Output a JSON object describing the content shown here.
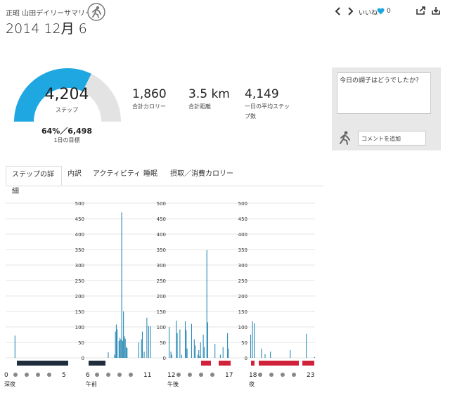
{
  "header": {
    "title": "正昭 山田デイリーサマリー",
    "date": "2014 12月 6",
    "like_label": "いいね",
    "like_count": "0"
  },
  "summary": {
    "steps": "4,204",
    "steps_label": "ステップ",
    "goal_text": "64%／6,498",
    "goal_label": "1日の目標",
    "goal_fraction": 0.647,
    "calories": "1,860",
    "calories_label": "合計カロリー",
    "distance": "3.5 km",
    "distance_label": "合計距離",
    "avg_steps": "4,149",
    "avg_steps_label_1": "一日の平均ステッ",
    "avg_steps_label_2": "プ数"
  },
  "comment": {
    "placeholder": "今日の調子はどうでしたか？",
    "add_button": "コメントを追加"
  },
  "tabs": [
    "ステップの詳細",
    "内訳",
    "アクティビティ",
    "睡眠",
    "摂取／消費カロリー"
  ],
  "colors": {
    "accent": "#1ea7e1",
    "bar": "#2a8ab5",
    "gauge_rest": "#e3e3e3",
    "sleep_dark": "#1f2d3d",
    "sleep_red": "#d0223a"
  },
  "chart_data": {
    "type": "bar",
    "ylim": [
      0,
      500
    ],
    "yticks": [
      "500",
      "450",
      "400",
      "350",
      "300",
      "250",
      "200",
      "150",
      "100",
      "50",
      "0"
    ],
    "panels": [
      {
        "period": "深夜",
        "start_hour": 0,
        "x_labels": [
          "0",
          "5"
        ],
        "values": [
          0,
          0,
          0,
          0,
          0,
          0,
          0,
          0,
          0,
          0,
          72,
          0,
          0,
          0,
          0,
          0,
          0,
          0,
          0,
          0,
          0,
          0,
          0,
          0,
          0,
          0,
          0,
          0,
          0,
          0,
          0,
          0,
          0,
          0,
          0,
          0,
          0,
          0,
          0,
          0,
          0,
          0,
          0,
          0,
          0,
          0,
          0,
          0,
          0,
          0,
          0,
          0,
          0,
          0,
          0,
          0,
          0,
          0,
          0,
          0,
          0,
          0,
          0,
          0,
          0,
          0,
          0,
          0,
          0,
          0,
          0,
          0
        ]
      },
      {
        "period": "午前",
        "start_hour": 6,
        "x_labels": [
          "6",
          "11"
        ],
        "values": [
          0,
          0,
          0,
          0,
          0,
          0,
          0,
          0,
          0,
          0,
          0,
          0,
          0,
          0,
          0,
          0,
          0,
          0,
          0,
          0,
          0,
          0,
          0,
          18,
          0,
          0,
          0,
          0,
          0,
          0,
          10,
          85,
          108,
          92,
          0,
          55,
          65,
          60,
          470,
          55,
          150,
          70,
          62,
          35,
          32,
          0,
          0,
          0,
          0,
          0,
          0,
          0,
          0,
          0,
          0,
          0,
          0,
          50,
          0,
          0,
          60,
          85,
          0,
          20,
          0,
          0,
          130,
          0,
          103,
          0,
          102,
          0
        ]
      },
      {
        "period": "午後",
        "start_hour": 12,
        "x_labels": [
          "12",
          "17"
        ],
        "values": [
          100,
          0,
          20,
          10,
          0,
          0,
          0,
          0,
          120,
          80,
          0,
          0,
          92,
          0,
          10,
          0,
          0,
          0,
          118,
          90,
          30,
          0,
          0,
          0,
          0,
          110,
          0,
          0,
          60,
          40,
          0,
          0,
          10,
          25,
          5,
          50,
          0,
          0,
          75,
          35,
          0,
          0,
          348,
          115,
          0,
          0,
          0,
          0,
          0,
          0,
          0,
          45,
          0,
          0,
          0,
          0,
          0,
          10,
          0,
          0,
          35,
          0,
          0,
          0,
          0,
          80,
          30,
          0,
          0,
          0,
          0,
          0
        ]
      },
      {
        "period": "夜",
        "start_hour": 18,
        "x_labels": [
          "18",
          "23"
        ],
        "values": [
          75,
          0,
          118,
          0,
          112,
          0,
          0,
          0,
          0,
          0,
          0,
          0,
          30,
          0,
          0,
          0,
          12,
          0,
          0,
          0,
          0,
          0,
          20,
          0,
          0,
          0,
          0,
          0,
          0,
          0,
          0,
          0,
          0,
          0,
          0,
          0,
          0,
          0,
          0,
          0,
          0,
          0,
          0,
          0,
          25,
          0,
          0,
          0,
          0,
          0,
          0,
          0,
          0,
          0,
          0,
          0,
          0,
          0,
          0,
          0,
          0,
          0,
          78,
          0,
          0,
          0,
          0,
          0,
          0,
          0,
          0,
          3
        ]
      }
    ]
  }
}
